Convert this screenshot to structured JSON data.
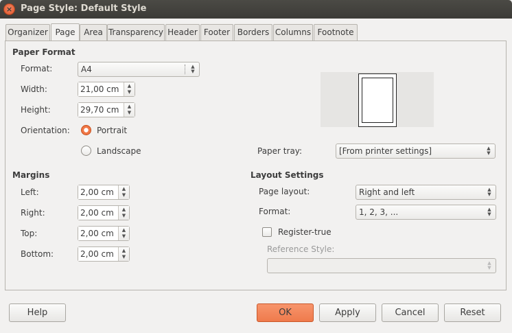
{
  "window": {
    "title": "Page Style: Default Style",
    "close_glyph": "×"
  },
  "tabs": [
    {
      "label": "Organizer"
    },
    {
      "label": "Page"
    },
    {
      "label": "Area"
    },
    {
      "label": "Transparency"
    },
    {
      "label": "Header"
    },
    {
      "label": "Footer"
    },
    {
      "label": "Borders"
    },
    {
      "label": "Columns"
    },
    {
      "label": "Footnote"
    }
  ],
  "active_tab": "Page",
  "paper_format": {
    "title": "Paper Format",
    "format_label": "Format:",
    "format_value": "A4",
    "width_label": "Width:",
    "width_value": "21,00 cm",
    "height_label": "Height:",
    "height_value": "29,70 cm",
    "orientation_label": "Orientation:",
    "portrait_label": "Portrait",
    "landscape_label": "Landscape",
    "orientation_selected": "Portrait",
    "paper_tray_label": "Paper tray:",
    "paper_tray_value": "[From printer settings]"
  },
  "margins": {
    "title": "Margins",
    "left_label": "Left:",
    "left_value": "2,00 cm",
    "right_label": "Right:",
    "right_value": "2,00 cm",
    "top_label": "Top:",
    "top_value": "2,00 cm",
    "bottom_label": "Bottom:",
    "bottom_value": "2,00 cm"
  },
  "layout": {
    "title": "Layout Settings",
    "page_layout_label": "Page layout:",
    "page_layout_value": "Right and left",
    "format_label": "Format:",
    "format_value": "1, 2, 3, ...",
    "register_true_label": "Register-true",
    "register_true_checked": false,
    "reference_style_label": "Reference Style:",
    "reference_style_value": ""
  },
  "buttons": {
    "help": "Help",
    "ok": "OK",
    "apply": "Apply",
    "cancel": "Cancel",
    "reset": "Reset"
  },
  "icons": {
    "spin_up": "▲",
    "spin_down": "▼",
    "combo_arrows": "▲▼"
  },
  "colors": {
    "accent": "#ef7a4c",
    "titlebar": "#3c3b37",
    "background": "#f2f1f0"
  }
}
